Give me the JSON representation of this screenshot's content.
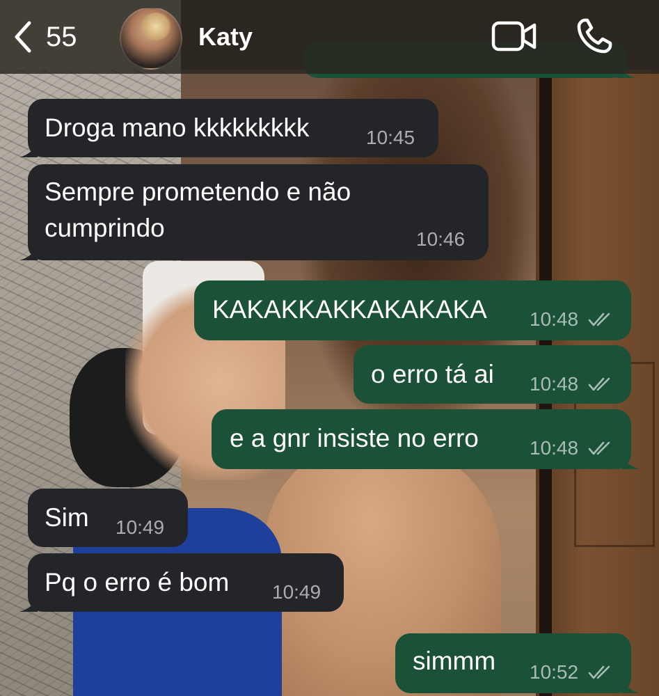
{
  "header": {
    "back_count": "55",
    "contact_name": "Katy",
    "icons": {
      "back": "chevron-left-icon",
      "video": "video-camera-icon",
      "call": "phone-icon"
    }
  },
  "messages": [
    {
      "direction": "in",
      "text": "Droga mano kkkkkkkkk",
      "time": "10:45"
    },
    {
      "direction": "in",
      "text_line1": "Sempre prometendo e não",
      "text_line2": "cumprindo",
      "time": "10:46"
    },
    {
      "direction": "out",
      "text": "KAKAKKAKKAKAKAKA",
      "time": "10:48",
      "status": "read"
    },
    {
      "direction": "out",
      "text": "o erro tá ai",
      "time": "10:48",
      "status": "read"
    },
    {
      "direction": "out",
      "text": "e a gnr insiste no erro",
      "time": "10:48",
      "status": "read"
    },
    {
      "direction": "in",
      "text": "Sim",
      "time": "10:49"
    },
    {
      "direction": "in",
      "text": "Pq o erro é bom",
      "time": "10:49"
    },
    {
      "direction": "out",
      "text": "simmm",
      "time": "10:52",
      "status": "read"
    }
  ],
  "colors": {
    "incoming_bubble": "#242529",
    "outgoing_bubble": "#1a5137",
    "header_bg": "#28261e",
    "text": "#ffffff"
  }
}
